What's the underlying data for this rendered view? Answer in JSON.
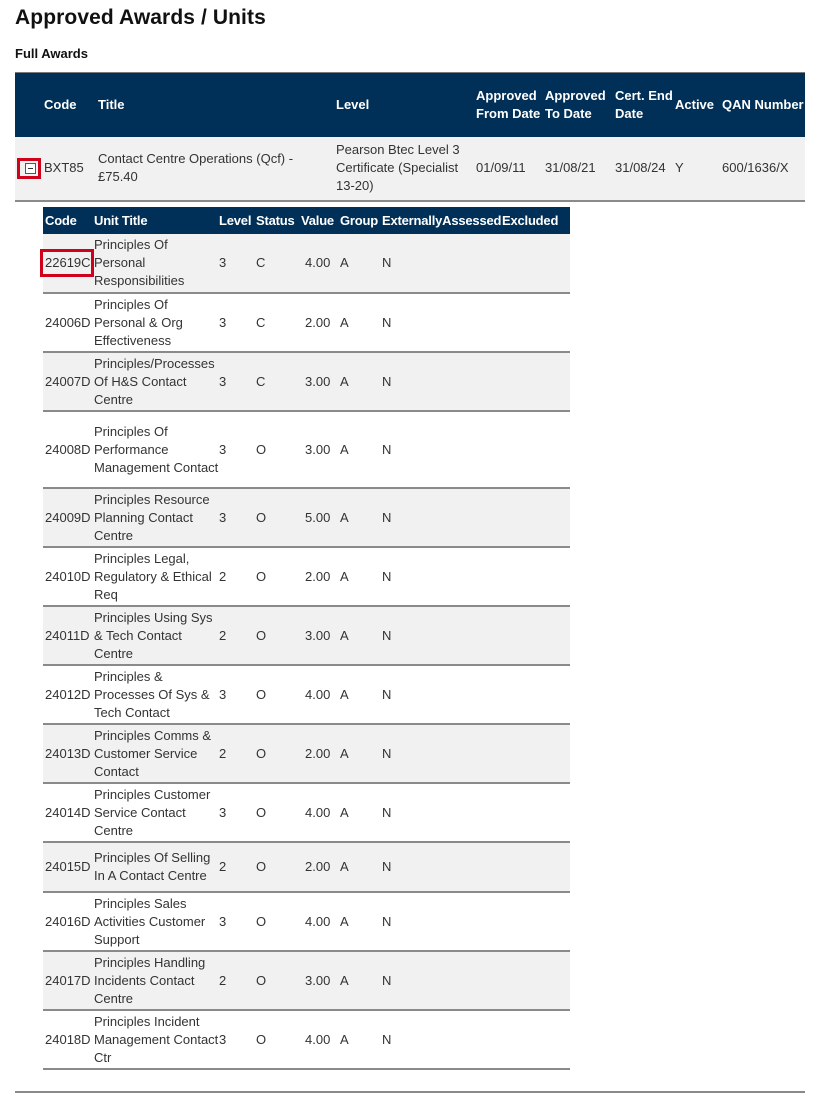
{
  "page": {
    "title": "Approved Awards / Units",
    "section_title": "Full Awards",
    "highlight_color": "#d0021b",
    "header_color": "#002f57"
  },
  "awards_table": {
    "headers": {
      "code": "Code",
      "title": "Title",
      "level": "Level",
      "approved_from_date": "Approved From Date",
      "approved_to_date": "Approved To Date",
      "cert_end_date": "Cert. End Date",
      "active": "Active",
      "qan_number": "QAN Number"
    },
    "rows": [
      {
        "toggle_icon": "collapse-minus-icon",
        "code": "BXT85",
        "title": "Contact Centre Operations (Qcf) - £75.40",
        "level": "Pearson Btec Level 3 Certificate (Specialist 13-20)",
        "approved_from_date": "01/09/11",
        "approved_to_date": "31/08/21",
        "cert_end_date": "31/08/24",
        "active": "Y",
        "qan_number": "600/1636/X"
      }
    ]
  },
  "units_table": {
    "headers": {
      "code": "Code",
      "unit_title": "Unit Title",
      "level": "Level",
      "status": "Status",
      "value": "Value",
      "group": "Group",
      "externally_assessed": "ExternallyAssessed",
      "excluded": "Excluded"
    },
    "rows": [
      {
        "code": "22619C",
        "unit_title": "Principles Of Personal Responsibilities",
        "level": "3",
        "status": "C",
        "value": "4.00",
        "group": "A",
        "externally_assessed": "N",
        "excluded": ""
      },
      {
        "code": "24006D",
        "unit_title": "Principles Of Personal & Org Effectiveness",
        "level": "3",
        "status": "C",
        "value": "2.00",
        "group": "A",
        "externally_assessed": "N",
        "excluded": ""
      },
      {
        "code": "24007D",
        "unit_title": "Principles/Processes Of H&S Contact Centre",
        "level": "3",
        "status": "C",
        "value": "3.00",
        "group": "A",
        "externally_assessed": "N",
        "excluded": ""
      },
      {
        "code": "24008D",
        "unit_title": "Principles Of Performance Management Contact",
        "level": "3",
        "status": "O",
        "value": "3.00",
        "group": "A",
        "externally_assessed": "N",
        "excluded": ""
      },
      {
        "code": "24009D",
        "unit_title": "Principles Resource Planning Contact Centre",
        "level": "3",
        "status": "O",
        "value": "5.00",
        "group": "A",
        "externally_assessed": "N",
        "excluded": ""
      },
      {
        "code": "24010D",
        "unit_title": "Principles Legal, Regulatory & Ethical Req",
        "level": "2",
        "status": "O",
        "value": "2.00",
        "group": "A",
        "externally_assessed": "N",
        "excluded": ""
      },
      {
        "code": "24011D",
        "unit_title": "Principles Using Sys & Tech Contact Centre",
        "level": "2",
        "status": "O",
        "value": "3.00",
        "group": "A",
        "externally_assessed": "N",
        "excluded": ""
      },
      {
        "code": "24012D",
        "unit_title": "Principles & Processes Of Sys & Tech Contact",
        "level": "3",
        "status": "O",
        "value": "4.00",
        "group": "A",
        "externally_assessed": "N",
        "excluded": ""
      },
      {
        "code": "24013D",
        "unit_title": "Principles Comms & Customer Service Contact",
        "level": "2",
        "status": "O",
        "value": "2.00",
        "group": "A",
        "externally_assessed": "N",
        "excluded": ""
      },
      {
        "code": "24014D",
        "unit_title": "Principles Customer Service Contact Centre",
        "level": "3",
        "status": "O",
        "value": "4.00",
        "group": "A",
        "externally_assessed": "N",
        "excluded": ""
      },
      {
        "code": "24015D",
        "unit_title": "Principles Of Selling In A Contact Centre",
        "level": "2",
        "status": "O",
        "value": "2.00",
        "group": "A",
        "externally_assessed": "N",
        "excluded": ""
      },
      {
        "code": "24016D",
        "unit_title": "Principles Sales Activities Customer Support",
        "level": "3",
        "status": "O",
        "value": "4.00",
        "group": "A",
        "externally_assessed": "N",
        "excluded": ""
      },
      {
        "code": "24017D",
        "unit_title": "Principles Handling Incidents Contact Centre",
        "level": "2",
        "status": "O",
        "value": "3.00",
        "group": "A",
        "externally_assessed": "N",
        "excluded": ""
      },
      {
        "code": "24018D",
        "unit_title": "Principles Incident Management Contact Ctr",
        "level": "3",
        "status": "O",
        "value": "4.00",
        "group": "A",
        "externally_assessed": "N",
        "excluded": ""
      }
    ]
  }
}
